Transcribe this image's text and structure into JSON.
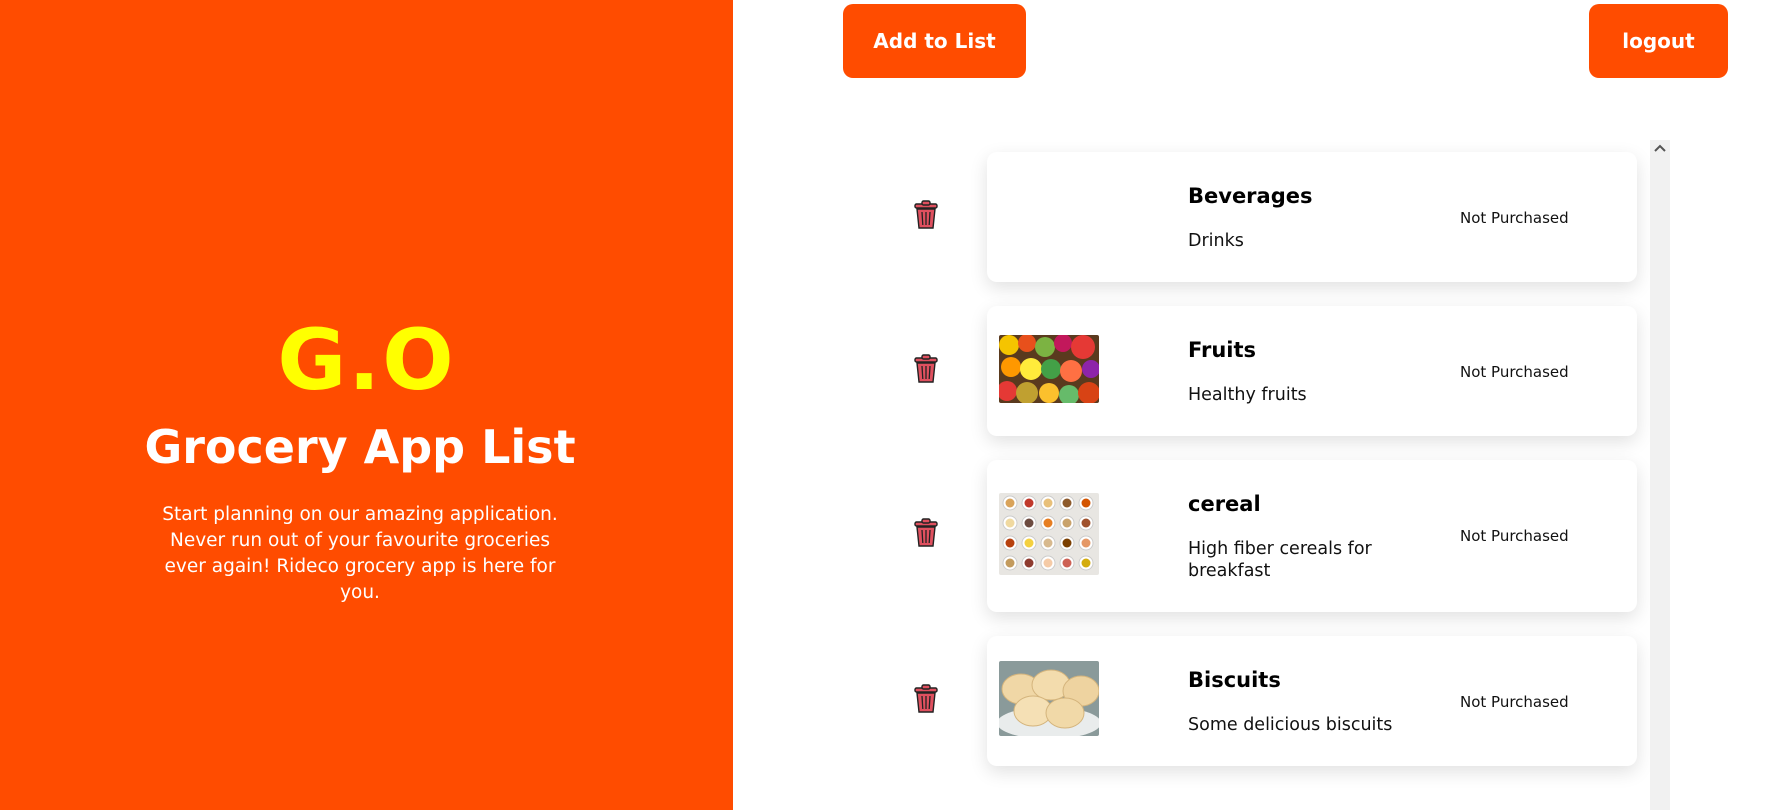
{
  "hero": {
    "logo": "G.O",
    "title": "Grocery App List",
    "description": "Start planning on our amazing application. Never run out of your favourite groceries ever again! Rideco grocery app is here for you."
  },
  "toolbar": {
    "add_label": "Add to List",
    "logout_label": "logout"
  },
  "items": [
    {
      "name": "Beverages",
      "description": "Drinks",
      "status": "Not Purchased",
      "image": "none"
    },
    {
      "name": "Fruits",
      "description": "Healthy fruits",
      "status": "Not Purchased",
      "image": "fruits-photo"
    },
    {
      "name": "cereal",
      "description": "High fiber cereals for breakfast",
      "status": "Not Purchased",
      "image": "cereal-bowls-photo"
    },
    {
      "name": "Biscuits",
      "description": "Some delicious biscuits",
      "status": "Not Purchased",
      "image": "biscuits-photo"
    }
  ],
  "colors": {
    "brand": "#ff4c00",
    "logo": "#ffff00",
    "trash": "#e0505f"
  },
  "icons": {
    "delete": "trash-icon",
    "scroll_up": "chevron-up-icon"
  }
}
